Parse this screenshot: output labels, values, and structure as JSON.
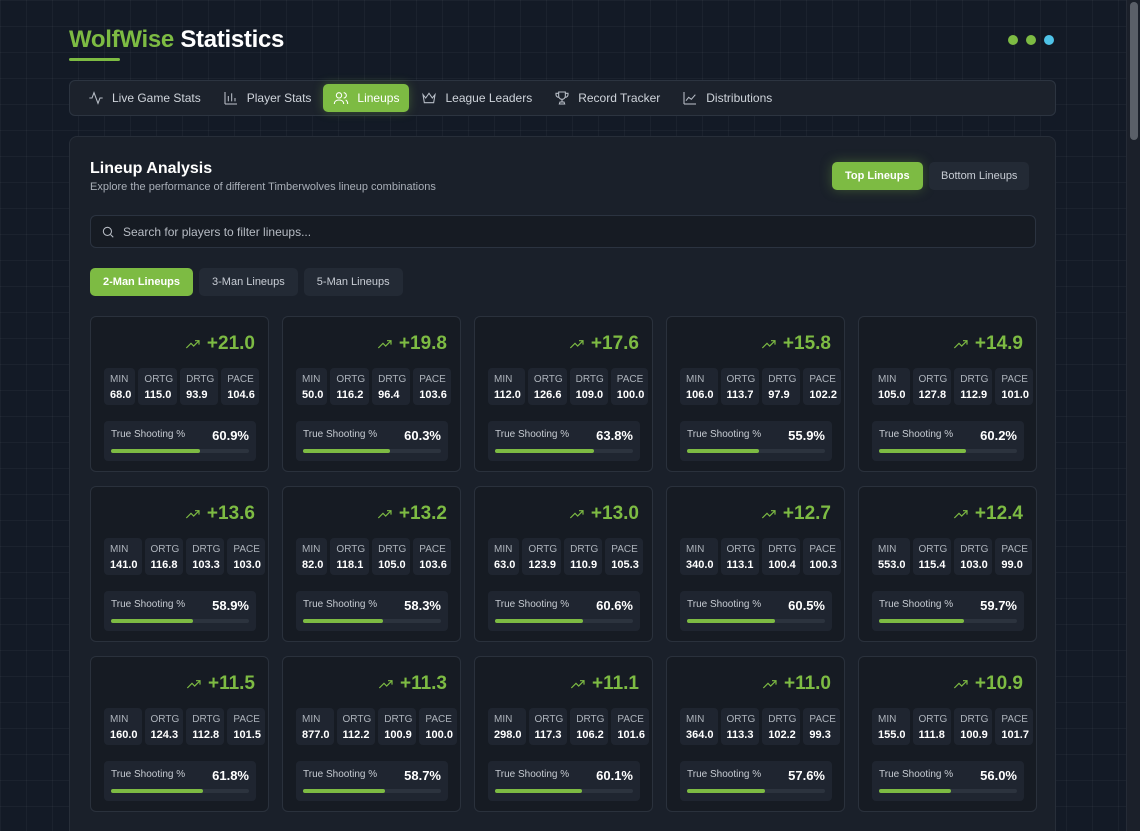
{
  "app": {
    "title_brand": "WolfWise",
    "title_rest": "Statistics",
    "dot_colors": [
      "#7dbb43",
      "#7dbb43",
      "#4fc3e8"
    ]
  },
  "nav": {
    "items": [
      {
        "label": "Live Game Stats",
        "icon": "activity-icon"
      },
      {
        "label": "Player Stats",
        "icon": "bar-chart-icon"
      },
      {
        "label": "Lineups",
        "icon": "users-icon",
        "active": true
      },
      {
        "label": "League Leaders",
        "icon": "crown-icon"
      },
      {
        "label": "Record Tracker",
        "icon": "trophy-icon"
      },
      {
        "label": "Distributions",
        "icon": "line-chart-icon"
      }
    ]
  },
  "panel": {
    "title": "Lineup Analysis",
    "subtitle": "Explore the performance of different Timberwolves lineup combinations",
    "toggle": {
      "top": "Top Lineups",
      "bottom": "Bottom Lineups",
      "selected": "top"
    },
    "search_placeholder": "Search for players to filter lineups...",
    "subtabs": [
      "2-Man Lineups",
      "3-Man Lineups",
      "5-Man Lineups"
    ],
    "subtab_selected": 0
  },
  "stat_labels": {
    "min": "MIN",
    "ortg": "ORTG",
    "drtg": "DRTG",
    "pace": "PACE",
    "ts": "True Shooting %"
  },
  "colors": {
    "accent": "#7dbb43",
    "panel": "#1a202a",
    "card": "#161b23"
  },
  "lineups": [
    {
      "net": "+21.0",
      "min": "68.0",
      "ortg": "115.0",
      "drtg": "93.9",
      "pace": "104.6",
      "ts": "60.9%",
      "ts_pct": 60.9
    },
    {
      "net": "+19.8",
      "min": "50.0",
      "ortg": "116.2",
      "drtg": "96.4",
      "pace": "103.6",
      "ts": "60.3%",
      "ts_pct": 60.3
    },
    {
      "net": "+17.6",
      "min": "112.0",
      "ortg": "126.6",
      "drtg": "109.0",
      "pace": "100.0",
      "ts": "63.8%",
      "ts_pct": 63.8
    },
    {
      "net": "+15.8",
      "min": "106.0",
      "ortg": "113.7",
      "drtg": "97.9",
      "pace": "102.2",
      "ts": "55.9%",
      "ts_pct": 55.9
    },
    {
      "net": "+14.9",
      "min": "105.0",
      "ortg": "127.8",
      "drtg": "112.9",
      "pace": "101.0",
      "ts": "60.2%",
      "ts_pct": 60.2
    },
    {
      "net": "+13.6",
      "min": "141.0",
      "ortg": "116.8",
      "drtg": "103.3",
      "pace": "103.0",
      "ts": "58.9%",
      "ts_pct": 58.9
    },
    {
      "net": "+13.2",
      "min": "82.0",
      "ortg": "118.1",
      "drtg": "105.0",
      "pace": "103.6",
      "ts": "58.3%",
      "ts_pct": 58.3
    },
    {
      "net": "+13.0",
      "min": "63.0",
      "ortg": "123.9",
      "drtg": "110.9",
      "pace": "105.3",
      "ts": "60.6%",
      "ts_pct": 60.6
    },
    {
      "net": "+12.7",
      "min": "340.0",
      "ortg": "113.1",
      "drtg": "100.4",
      "pace": "100.3",
      "ts": "60.5%",
      "ts_pct": 60.5
    },
    {
      "net": "+12.4",
      "min": "553.0",
      "ortg": "115.4",
      "drtg": "103.0",
      "pace": "99.0",
      "ts": "59.7%",
      "ts_pct": 59.7
    },
    {
      "net": "+11.5",
      "min": "160.0",
      "ortg": "124.3",
      "drtg": "112.8",
      "pace": "101.5",
      "ts": "61.8%",
      "ts_pct": 61.8
    },
    {
      "net": "+11.3",
      "min": "877.0",
      "ortg": "112.2",
      "drtg": "100.9",
      "pace": "100.0",
      "ts": "58.7%",
      "ts_pct": 58.7
    },
    {
      "net": "+11.1",
      "min": "298.0",
      "ortg": "117.3",
      "drtg": "106.2",
      "pace": "101.6",
      "ts": "60.1%",
      "ts_pct": 60.1
    },
    {
      "net": "+11.0",
      "min": "364.0",
      "ortg": "113.3",
      "drtg": "102.2",
      "pace": "99.3",
      "ts": "57.6%",
      "ts_pct": 57.6
    },
    {
      "net": "+10.9",
      "min": "155.0",
      "ortg": "111.8",
      "drtg": "100.9",
      "pace": "101.7",
      "ts": "56.0%",
      "ts_pct": 56.0
    }
  ]
}
